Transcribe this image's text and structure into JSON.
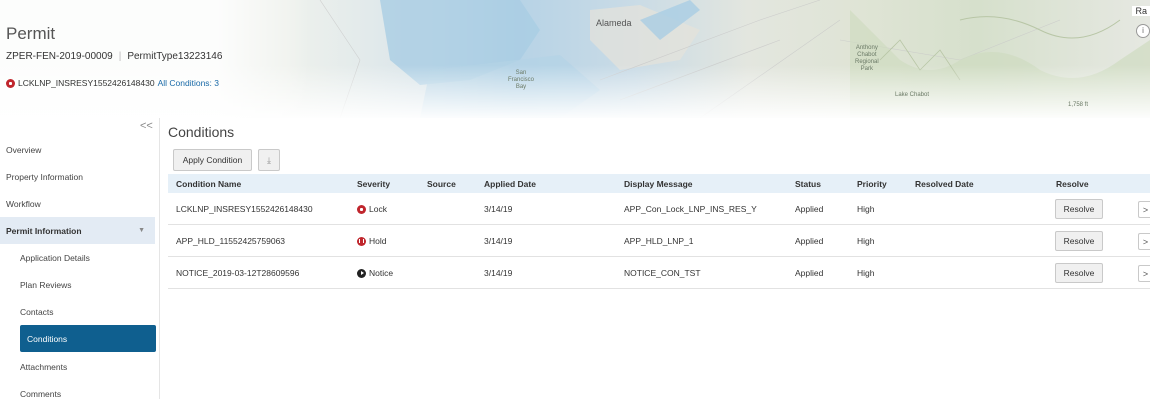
{
  "header": {
    "title": "Permit",
    "record_id": "ZPER-FEN-2019-00009",
    "record_type": "PermitType13223146",
    "condition_name": "LCKLNP_INSRESY1552426148430",
    "all_conditions_label": "All Conditions: 3",
    "map_labels": {
      "alameda": "Alameda",
      "park": "Anthony\nChabot\nRegional\nPark",
      "ra": "Ra",
      "info": "i",
      "san_francisco": "San\nFrancisco\nBay",
      "lake_chabot": "Lake Chabot",
      "elevation": "1,758 ft"
    }
  },
  "sidebar": {
    "collapse_icon": "<<",
    "items": [
      {
        "label": "Overview",
        "type": "top"
      },
      {
        "label": "Property Information",
        "type": "top"
      },
      {
        "label": "Workflow",
        "type": "top"
      },
      {
        "label": "Permit Information",
        "type": "group"
      },
      {
        "label": "Application Details",
        "type": "sub"
      },
      {
        "label": "Plan Reviews",
        "type": "sub"
      },
      {
        "label": "Contacts",
        "type": "sub"
      },
      {
        "label": "Conditions",
        "type": "active"
      },
      {
        "label": "Attachments",
        "type": "sub"
      },
      {
        "label": "Comments",
        "type": "sub"
      }
    ]
  },
  "main": {
    "title": "Conditions",
    "apply_button": "Apply Condition",
    "download_icon": "⤓",
    "columns": {
      "name": "Condition Name",
      "severity": "Severity",
      "source": "Source",
      "applied": "Applied Date",
      "message": "Display Message",
      "status": "Status",
      "priority": "Priority",
      "resolved": "Resolved Date",
      "resolve": "Resolve"
    },
    "rows": [
      {
        "name": "LCKLNP_INSRESY1552426148430",
        "severity": "Lock",
        "severity_icon": "lock-icon",
        "source": "",
        "applied": "3/14/19",
        "message": "APP_Con_Lock_LNP_INS_RES_Y",
        "status": "Applied",
        "priority": "High",
        "resolved": "",
        "resolve_label": "Resolve",
        "more": ">"
      },
      {
        "name": "APP_HLD_11552425759063",
        "severity": "Hold",
        "severity_icon": "hold-icon",
        "source": "",
        "applied": "3/14/19",
        "message": "APP_HLD_LNP_1",
        "status": "Applied",
        "priority": "High",
        "resolved": "",
        "resolve_label": "Resolve",
        "more": ">"
      },
      {
        "name": "NOTICE_2019-03-12T28609596",
        "severity": "Notice",
        "severity_icon": "notice-icon",
        "source": "",
        "applied": "3/14/19",
        "message": "NOTICE_CON_TST",
        "status": "Applied",
        "priority": "High",
        "resolved": "",
        "resolve_label": "Resolve",
        "more": ">"
      }
    ]
  },
  "colors": {
    "accent": "#0f5f8f",
    "link": "#1a6aa8",
    "lock_red": "#c0262d",
    "header_bg": "#e6f0f8",
    "group_bg": "#e3ebf4"
  }
}
